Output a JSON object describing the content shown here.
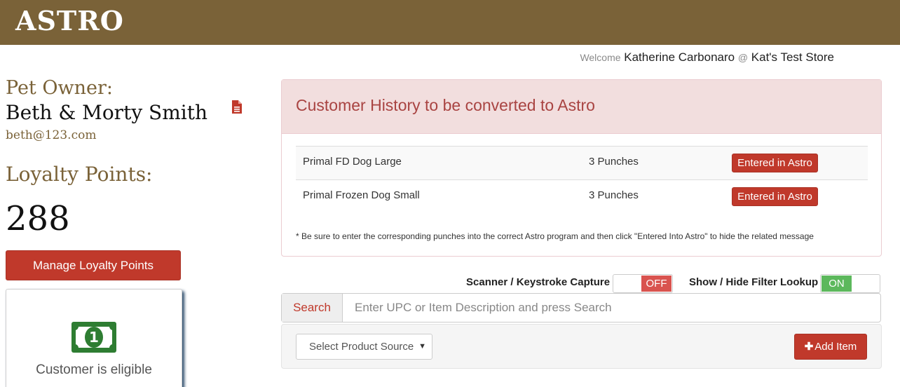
{
  "header": {
    "logo": "ASTRO"
  },
  "welcome": {
    "prefix": "Welcome",
    "user": "Katherine Carbonaro",
    "at": "@",
    "store": "Kat's Test Store"
  },
  "owner": {
    "label": "Pet Owner:",
    "name": "Beth & Morty Smith",
    "email": "beth@123.com",
    "doc_icon": "document-icon"
  },
  "loyalty": {
    "label": "Loyalty Points:",
    "points": "288",
    "manage_button": "Manage Loyalty Points",
    "card_icon": "money-bill-icon",
    "eligible_text": "Customer is eligible"
  },
  "history": {
    "title": "Customer History to be converted to Astro",
    "rows": [
      {
        "product": "Primal FD Dog Large",
        "punches": "3 Punches",
        "action": "Entered in Astro"
      },
      {
        "product": "Primal Frozen Dog Small",
        "punches": "3 Punches",
        "action": "Entered in Astro"
      }
    ],
    "note": "* Be sure to enter the corresponding punches into the correct Astro program and then click \"Entered Into Astro\" to hide the related message"
  },
  "toggles": {
    "scanner": {
      "label": "Scanner / Keystroke Capture",
      "state": "OFF"
    },
    "filter": {
      "label": "Show / Hide Filter Lookup",
      "state": "ON"
    }
  },
  "search": {
    "button": "Search",
    "placeholder": "Enter UPC or Item Description and press Search"
  },
  "filters": {
    "source_select": "Select Product Source",
    "add_button": "Add Item"
  },
  "colors": {
    "brand": "#7a6238",
    "danger": "#c0392b",
    "success": "#5cb85c",
    "alert_bg": "#f2dede",
    "alert_text": "#a94442"
  }
}
